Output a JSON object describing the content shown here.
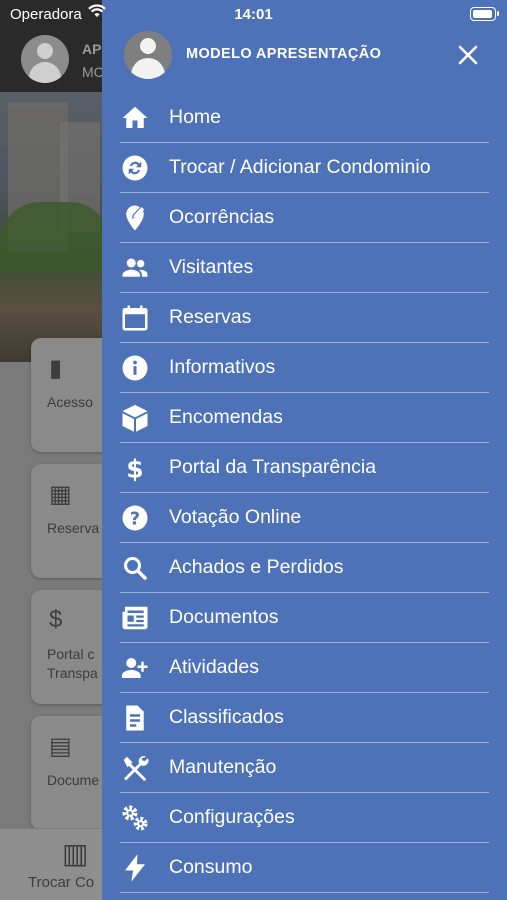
{
  "status_bar": {
    "carrier": "Operadora",
    "time": "14:01"
  },
  "background_app": {
    "header_name": "AP",
    "header_sub": "MC",
    "cards": [
      {
        "label": "Acesso",
        "icon": "door-icon"
      },
      {
        "label": "Reserva",
        "icon": "calendar-icon"
      },
      {
        "label": "Portal c\nTranspa",
        "icon": "dollar-icon"
      },
      {
        "label": "Docume",
        "icon": "newspaper-icon"
      }
    ],
    "bottom_bar_label": "Trocar Co"
  },
  "drawer": {
    "title": "MODELO APRESENTAÇÃO",
    "items": [
      {
        "label": "Home",
        "icon": "home-icon"
      },
      {
        "label": "Trocar / Adicionar Condominio",
        "icon": "swap-icon"
      },
      {
        "label": "Ocorrências",
        "icon": "edit-location-icon"
      },
      {
        "label": "Visitantes",
        "icon": "people-icon"
      },
      {
        "label": "Reservas",
        "icon": "calendar-icon"
      },
      {
        "label": "Informativos",
        "icon": "info-icon"
      },
      {
        "label": "Encomendas",
        "icon": "package-icon"
      },
      {
        "label": "Portal da Transparência",
        "icon": "dollar-icon"
      },
      {
        "label": "Votação Online",
        "icon": "help-icon"
      },
      {
        "label": "Achados e Perdidos",
        "icon": "search-icon"
      },
      {
        "label": "Documentos",
        "icon": "newspaper-icon"
      },
      {
        "label": "Atividades",
        "icon": "person-add-icon"
      },
      {
        "label": "Classificados",
        "icon": "document-icon"
      },
      {
        "label": "Manutenção",
        "icon": "tools-icon"
      },
      {
        "label": "Configurações",
        "icon": "gears-icon"
      },
      {
        "label": "Consumo",
        "icon": "lightning-icon"
      }
    ]
  }
}
